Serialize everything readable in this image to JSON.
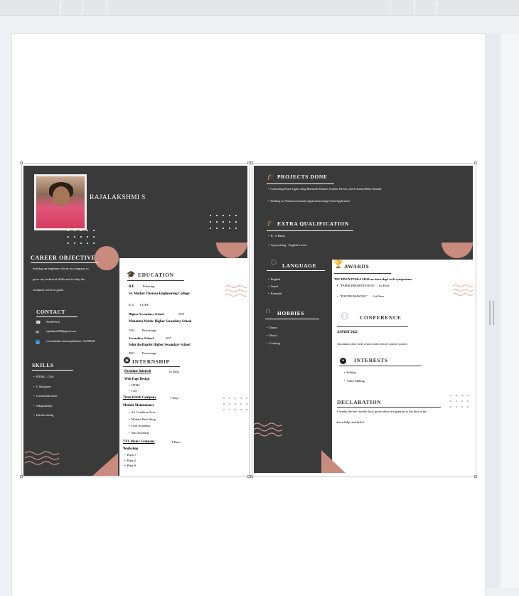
{
  "resume_page1": {
    "name": "RAJALAKSHMI S",
    "career_objective": {
      "heading": "CAREER OBJECTIVE",
      "lines": [
        "Seeking an beginner role in an company to",
        "grow my technical skills and to help the",
        "company meet its goals."
      ]
    },
    "contact": {
      "heading": "CONTACT",
      "phone": "9514997023",
      "email": "rajisankar2002@gmail.com",
      "linkedin": "www.linkedin.com/in/rajalakshmi-s-3b1889224"
    },
    "skills": {
      "heading": "SKILLS",
      "items": [
        "HTML , CSS",
        "C Beginner",
        "Communication",
        "Adaptability",
        "Hardworking"
      ]
    },
    "education": {
      "heading": "EDUCATION",
      "degree": "B.E",
      "degree_status": "Pursuing",
      "college": "St. Mother Theresa Engineering College",
      "cgpa": "8.51",
      "cgpa_label": "CGPA",
      "hsc": "Higher Secondary School",
      "hsc_year": "2019",
      "hsc_school": "Mahatma Matric Higher Secondary School",
      "hsc_pct": "74%",
      "hsc_pct_label": "Percentage",
      "sslc": "Secondary School",
      "sslc_year": "2017",
      "sslc_school": "John the Baptist Higher Secondary School",
      "sslc_pct": "90%",
      "sslc_pct_label": "Percentage"
    },
    "internship": {
      "heading": "INTERNSHIP",
      "i1_company": "Postulate Infotech",
      "i1_days": "14 Days",
      "i1_topic": "Web Page Design",
      "i1_items": [
        "HTML",
        "CSS"
      ],
      "i2_company": "Titan Watch Company",
      "i2_days": "7 Days",
      "i2_topic": "Module Maintanence",
      "i2_items": [
        "Air Condition Area",
        "Module Press Shop",
        "Gear Assembly",
        "Sub Assembly"
      ],
      "i3_company": "TVS Motor Company",
      "i3_days": "3 Days",
      "i3_topic": "Workshop",
      "i3_items": [
        "Plant 1",
        "Plant 2",
        "Plant 9"
      ]
    }
  },
  "resume_page2": {
    "projects": {
      "heading": "PROJECTS DONE",
      "items": [
        "Controlling Home Lights using Bluetooth Module, Arduino Device, and 4-channel Relay Module",
        "Working on 'Nutrition Assistant Application Using Cloud Application'"
      ]
    },
    "extra": {
      "heading": "EXTRA QUALIFICATION",
      "items": [
        "B . A Hindi",
        "Typewriting - English Lower"
      ]
    },
    "language": {
      "heading": "LANGUAGE",
      "items": [
        "English",
        "Tamil",
        "Kannada"
      ]
    },
    "hobbies": {
      "heading": "HOBBIES",
      "items": [
        "Dance",
        "Music",
        "Cooking"
      ]
    },
    "awards": {
      "heading": "AWARDS",
      "event": "TECHNOVIVEKA 2K20 an intra dept tech symposium",
      "a1": "\"PAPER PRESENTATION\"",
      "a1_prize": "- 1st Prize",
      "a2": "\"POSTER MAKING\"",
      "a2_prize": "- 1st Prize"
    },
    "conference": {
      "heading": "CONFERENCE",
      "name": "ASIART 2022",
      "desc": "Automatic door lock system with remote control system"
    },
    "interests": {
      "heading": "INTERESTS",
      "items": [
        "Editing",
        "Video Making"
      ]
    },
    "declaration": {
      "heading": "DECLARATION",
      "lines": [
        "I hereby declare that the facts given above are genuine to the best of my",
        "knowledge and belief"
      ]
    }
  },
  "colors": {
    "dark": "#3b3a3b",
    "accent": "#c98b7d",
    "wave": "#e8a9a0"
  }
}
